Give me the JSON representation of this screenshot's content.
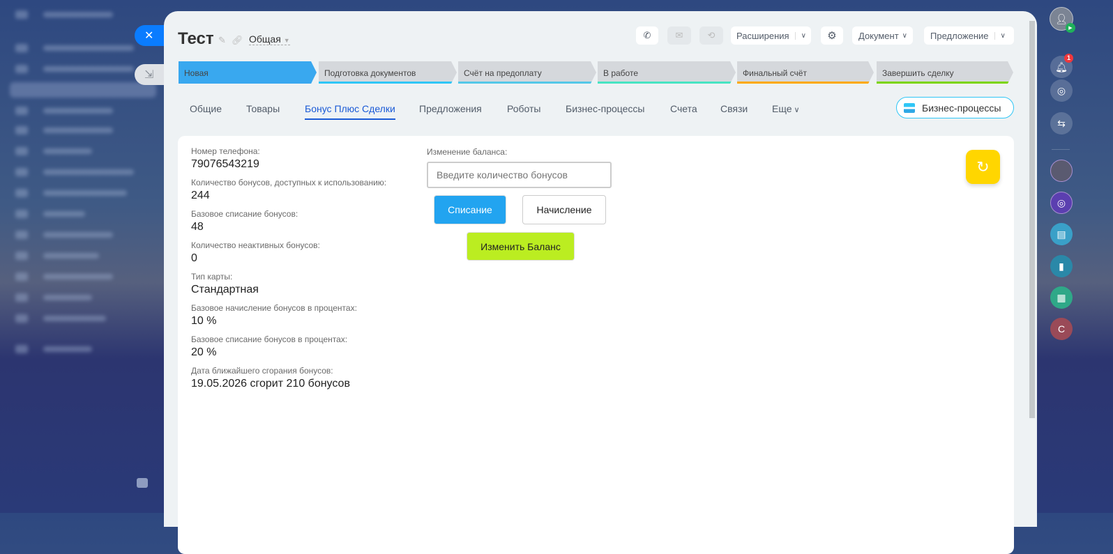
{
  "header": {
    "title": "Тест",
    "category": "Общая"
  },
  "toolbar": {
    "extensions": "Расширения",
    "document": "Документ",
    "offer": "Предложение"
  },
  "stages": [
    {
      "label": "Новая",
      "color": "#39a8ef"
    },
    {
      "label": "Подготовка документов",
      "color": "#2fc6f6"
    },
    {
      "label": "Счёт на предоплату",
      "color": "#55c8e8"
    },
    {
      "label": "В работе",
      "color": "#47e4c2"
    },
    {
      "label": "Финальный счёт",
      "color": "#ffa900"
    },
    {
      "label": "Завершить сделку",
      "color": "#7bd500"
    }
  ],
  "tabs": [
    "Общие",
    "Товары",
    "Бонус Плюс Сделки",
    "Предложения",
    "Роботы",
    "Бизнес-процессы",
    "Счета",
    "Связи",
    "Еще"
  ],
  "active_tab": "Бонус Плюс Сделки",
  "bp_button": "Бизнес-процессы",
  "fields": [
    {
      "label": "Номер телефона:",
      "value": "79076543219"
    },
    {
      "label": "Количество бонусов, доступных к использованию:",
      "value": "244"
    },
    {
      "label": "Базовое списание бонусов:",
      "value": "48"
    },
    {
      "label": "Количество неактивных бонусов:",
      "value": "0"
    },
    {
      "label": "Тип карты:",
      "value": "Стандартная"
    },
    {
      "label": "Базовое начисление бонусов в процентах:",
      "value": "10 %"
    },
    {
      "label": "Базовое списание бонусов в процентах:",
      "value": "20 %"
    },
    {
      "label": "Дата ближайшего сгорания бонусов:",
      "value": "19.05.2026 сгорит 210 бонусов"
    }
  ],
  "balance": {
    "label": "Изменение баланса:",
    "placeholder": "Введите количество бонусов",
    "writeoff": "Списание",
    "accrue": "Начисление",
    "change": "Изменить Баланс"
  },
  "rail": {
    "notification_count": "1",
    "user_initial": "С"
  }
}
